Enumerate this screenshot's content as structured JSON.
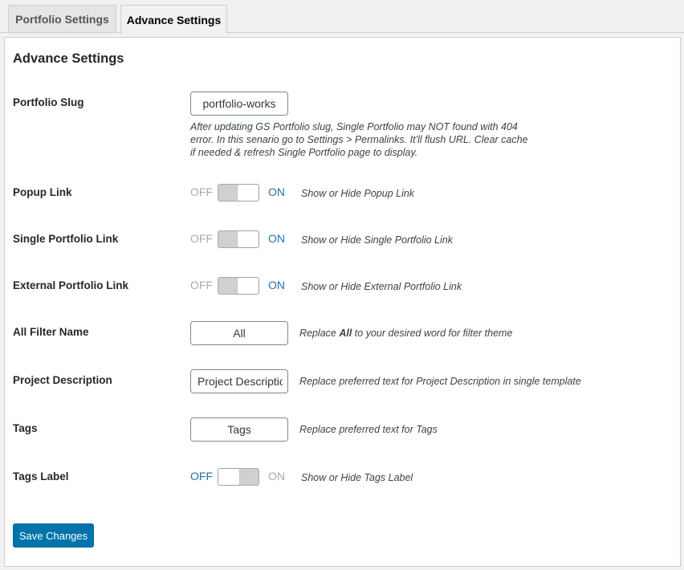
{
  "tabs": [
    {
      "label": "Portfolio Settings",
      "active": false
    },
    {
      "label": "Advance Settings",
      "active": true
    }
  ],
  "panel_title": "Advance Settings",
  "slug": {
    "label": "Portfolio Slug",
    "value": "portfolio-works",
    "help": "After updating GS Portfolio slug, Single Portfolio may NOT found with 404 error. In this senario go to Settings > Permalinks. It'll flush URL. Clear cache if needed & refresh Single Portfolio page to display."
  },
  "toggle_text": {
    "off": "OFF",
    "on": "ON"
  },
  "popup_link": {
    "label": "Popup Link",
    "state": "on",
    "help": "Show or Hide Popup Link"
  },
  "single_link": {
    "label": "Single Portfolio Link",
    "state": "on",
    "help": "Show or Hide Single Portfolio Link"
  },
  "external_link": {
    "label": "External Portfolio Link",
    "state": "on",
    "help": "Show or Hide External Portfolio Link"
  },
  "filter_name": {
    "label": "All Filter Name",
    "value": "All",
    "help_prefix": "Replace ",
    "help_bold": "All",
    "help_suffix": " to your desired word for filter theme"
  },
  "project_desc": {
    "label": "Project Description",
    "value": "Project Description",
    "help": "Replace preferred text for Project Description in single template"
  },
  "tags": {
    "label": "Tags",
    "value": "Tags",
    "help": "Replace preferred text for Tags"
  },
  "tags_label": {
    "label": "Tags Label",
    "state": "off",
    "help": "Show or Hide Tags Label"
  },
  "save_label": "Save Changes",
  "colors": {
    "accent": "#0073aa",
    "toggle_active": "#2271b1",
    "toggle_dim": "#a7aaad"
  }
}
